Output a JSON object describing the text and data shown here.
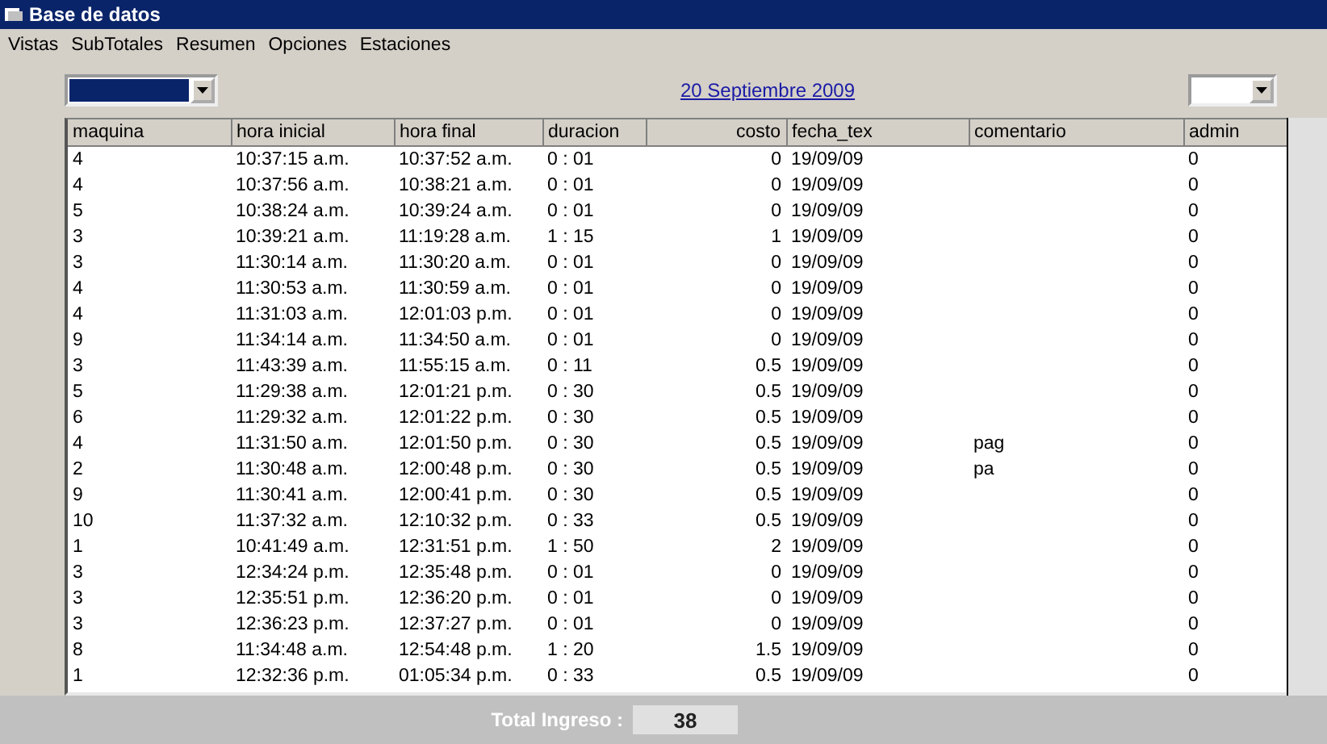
{
  "window": {
    "title": "Base de datos"
  },
  "menu": [
    "Vistas",
    "SubTotales",
    "Resumen",
    "Opciones",
    "Estaciones"
  ],
  "left_combo": {
    "highlighted": true
  },
  "date_link": "20 Septiembre 2009",
  "right_combo": {
    "highlighted": false
  },
  "table": {
    "columns": [
      {
        "label": "maquina",
        "kind": "text"
      },
      {
        "label": "hora inicial",
        "kind": "text"
      },
      {
        "label": "hora final",
        "kind": "text"
      },
      {
        "label": "duracion",
        "kind": "text"
      },
      {
        "label": "costo",
        "kind": "number"
      },
      {
        "label": "fecha_tex",
        "kind": "text"
      },
      {
        "label": "comentario",
        "kind": "text"
      },
      {
        "label": "admin",
        "kind": "text"
      }
    ],
    "rows": [
      [
        "4",
        "10:37:15 a.m.",
        "10:37:52 a.m.",
        "0 : 01",
        "0",
        "19/09/09",
        "",
        "0"
      ],
      [
        "4",
        "10:37:56 a.m.",
        "10:38:21 a.m.",
        "0 : 01",
        "0",
        "19/09/09",
        "",
        "0"
      ],
      [
        "5",
        "10:38:24 a.m.",
        "10:39:24 a.m.",
        "0 : 01",
        "0",
        "19/09/09",
        "",
        "0"
      ],
      [
        "3",
        "10:39:21 a.m.",
        "11:19:28 a.m.",
        "1 : 15",
        "1",
        "19/09/09",
        "",
        "0"
      ],
      [
        "3",
        "11:30:14 a.m.",
        "11:30:20 a.m.",
        "0 : 01",
        "0",
        "19/09/09",
        "",
        "0"
      ],
      [
        "4",
        "11:30:53 a.m.",
        "11:30:59 a.m.",
        "0 : 01",
        "0",
        "19/09/09",
        "",
        "0"
      ],
      [
        "4",
        "11:31:03 a.m.",
        "12:01:03 p.m.",
        "0 : 01",
        "0",
        "19/09/09",
        "",
        "0"
      ],
      [
        "9",
        "11:34:14 a.m.",
        "11:34:50 a.m.",
        "0 : 01",
        "0",
        "19/09/09",
        "",
        "0"
      ],
      [
        "3",
        "11:43:39 a.m.",
        "11:55:15 a.m.",
        "0 : 11",
        "0.5",
        "19/09/09",
        "",
        "0"
      ],
      [
        "5",
        "11:29:38 a.m.",
        "12:01:21 p.m.",
        "0 : 30",
        "0.5",
        "19/09/09",
        "",
        "0"
      ],
      [
        "6",
        "11:29:32 a.m.",
        "12:01:22 p.m.",
        "0 : 30",
        "0.5",
        "19/09/09",
        "",
        "0"
      ],
      [
        "4",
        "11:31:50 a.m.",
        "12:01:50 p.m.",
        "0 : 30",
        "0.5",
        "19/09/09",
        "pag",
        "0"
      ],
      [
        "2",
        "11:30:48 a.m.",
        "12:00:48 p.m.",
        "0 : 30",
        "0.5",
        "19/09/09",
        "pa",
        "0"
      ],
      [
        "9",
        "11:30:41 a.m.",
        "12:00:41 p.m.",
        "0 : 30",
        "0.5",
        "19/09/09",
        "",
        "0"
      ],
      [
        "10",
        "11:37:32 a.m.",
        "12:10:32 p.m.",
        "0 : 33",
        "0.5",
        "19/09/09",
        "",
        "0"
      ],
      [
        "1",
        "10:41:49 a.m.",
        "12:31:51 p.m.",
        "1 : 50",
        "2",
        "19/09/09",
        "",
        "0"
      ],
      [
        "3",
        "12:34:24 p.m.",
        "12:35:48 p.m.",
        "0 : 01",
        "0",
        "19/09/09",
        "",
        "0"
      ],
      [
        "3",
        "12:35:51 p.m.",
        "12:36:20 p.m.",
        "0 : 01",
        "0",
        "19/09/09",
        "",
        "0"
      ],
      [
        "3",
        "12:36:23 p.m.",
        "12:37:27 p.m.",
        "0 : 01",
        "0",
        "19/09/09",
        "",
        "0"
      ],
      [
        "8",
        "11:34:48 a.m.",
        "12:54:48 p.m.",
        "1 : 20",
        "1.5",
        "19/09/09",
        "",
        "0"
      ],
      [
        "1",
        "12:32:36 p.m.",
        "01:05:34 p.m.",
        "0 : 33",
        "0.5",
        "19/09/09",
        "",
        "0"
      ]
    ]
  },
  "total": {
    "label": "Total Ingreso :",
    "value": "38"
  }
}
